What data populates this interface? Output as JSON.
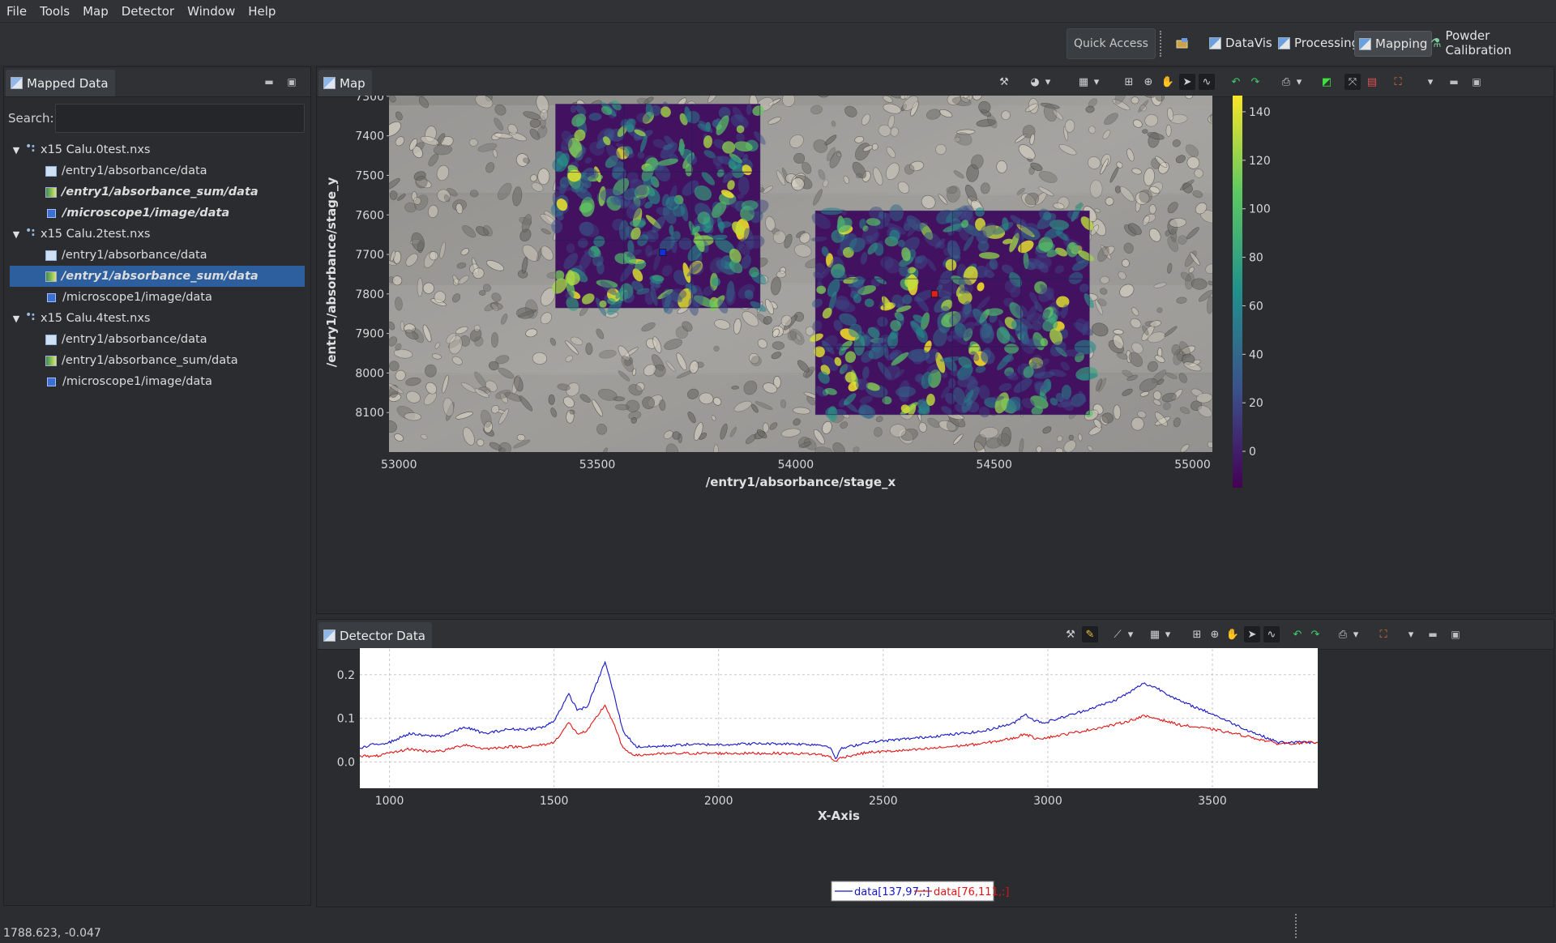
{
  "menu": [
    "File",
    "Tools",
    "Map",
    "Detector",
    "Window",
    "Help"
  ],
  "perspectives": {
    "quick_access": "Quick Access",
    "items": [
      {
        "label": "DataVis",
        "active": false
      },
      {
        "label": "Processing",
        "active": false
      },
      {
        "label": "Mapping",
        "active": true
      },
      {
        "label": "Powder Calibration",
        "active": false
      }
    ]
  },
  "mapped_data": {
    "tab_label": "Mapped Data",
    "search_label": "Search:",
    "search_value": "",
    "files": [
      {
        "name": "x15 Calu.0test.nxs",
        "datasets": [
          {
            "path": "/entry1/absorbance/data",
            "kind": "data",
            "emph": false,
            "selected": false
          },
          {
            "path": "/entry1/absorbance_sum/data",
            "kind": "sum",
            "emph": true,
            "selected": false
          },
          {
            "path": "/microscope1/image/data",
            "kind": "img",
            "emph": true,
            "selected": false
          }
        ]
      },
      {
        "name": "x15 Calu.2test.nxs",
        "datasets": [
          {
            "path": "/entry1/absorbance/data",
            "kind": "data",
            "emph": false,
            "selected": false
          },
          {
            "path": "/entry1/absorbance_sum/data",
            "kind": "sum",
            "emph": true,
            "selected": true
          },
          {
            "path": "/microscope1/image/data",
            "kind": "img",
            "emph": false,
            "selected": false
          }
        ]
      },
      {
        "name": "x15 Calu.4test.nxs",
        "datasets": [
          {
            "path": "/entry1/absorbance/data",
            "kind": "data",
            "emph": false,
            "selected": false
          },
          {
            "path": "/entry1/absorbance_sum/data",
            "kind": "sum",
            "emph": false,
            "selected": false
          },
          {
            "path": "/microscope1/image/data",
            "kind": "img",
            "emph": false,
            "selected": false
          }
        ]
      }
    ]
  },
  "map": {
    "tab_label": "Map",
    "chart_data": {
      "type": "heatmap",
      "xlabel": "/entry1/absorbance/stage_x",
      "ylabel": "/entry1/absorbance/stage_y",
      "xlim": [
        52975,
        55050
      ],
      "ylim": [
        7290,
        8200
      ],
      "x_ticks": [
        53000,
        53500,
        54000,
        54500,
        55000
      ],
      "y_ticks": [
        7300,
        7400,
        7500,
        7600,
        7700,
        7800,
        7900,
        8000,
        8100
      ],
      "colorbar": {
        "min": -15,
        "max": 148,
        "ticks": [
          0,
          20,
          40,
          60,
          80,
          100,
          120,
          140
        ],
        "colormap": "viridis"
      },
      "background_image": "microscope1 image (grayscale cells)",
      "overlays": [
        {
          "x_range": [
            53395,
            53910
          ],
          "y_range": [
            7320,
            7835
          ],
          "grid": [
            3,
            3
          ]
        },
        {
          "x_range": [
            54050,
            54740
          ],
          "y_range": [
            7590,
            8105
          ],
          "grid": [
            4,
            3
          ]
        }
      ],
      "markers": [
        {
          "x": 53665,
          "y": 7695,
          "color": "#1030e0"
        },
        {
          "x": 54350,
          "y": 7800,
          "color": "#e02020"
        }
      ]
    }
  },
  "detector": {
    "tab_label": "Detector Data",
    "chart_data": {
      "type": "line",
      "xlabel": "X-Axis",
      "ylabel": "",
      "xlim": [
        910,
        3820
      ],
      "ylim": [
        -0.06,
        0.27
      ],
      "x_ticks": [
        1000,
        1500,
        2000,
        2500,
        3000,
        3500
      ],
      "y_ticks": [
        0.0,
        0.1,
        0.2
      ],
      "grid": true,
      "legend": "bottom-center",
      "series": [
        {
          "name": "data[137,97,:]",
          "color": "#1515c8",
          "points": [
            [
              910,
              0.03
            ],
            [
              950,
              0.04
            ],
            [
              1000,
              0.045
            ],
            [
              1060,
              0.065
            ],
            [
              1110,
              0.06
            ],
            [
              1160,
              0.06
            ],
            [
              1230,
              0.08
            ],
            [
              1290,
              0.065
            ],
            [
              1360,
              0.075
            ],
            [
              1420,
              0.075
            ],
            [
              1470,
              0.08
            ],
            [
              1500,
              0.095
            ],
            [
              1530,
              0.135
            ],
            [
              1545,
              0.155
            ],
            [
              1570,
              0.12
            ],
            [
              1600,
              0.125
            ],
            [
              1640,
              0.2
            ],
            [
              1655,
              0.23
            ],
            [
              1680,
              0.16
            ],
            [
              1710,
              0.07
            ],
            [
              1750,
              0.035
            ],
            [
              1800,
              0.035
            ],
            [
              1900,
              0.04
            ],
            [
              2000,
              0.04
            ],
            [
              2100,
              0.042
            ],
            [
              2200,
              0.042
            ],
            [
              2300,
              0.04
            ],
            [
              2340,
              0.035
            ],
            [
              2355,
              0.005
            ],
            [
              2370,
              0.03
            ],
            [
              2450,
              0.045
            ],
            [
              2600,
              0.055
            ],
            [
              2800,
              0.07
            ],
            [
              2900,
              0.09
            ],
            [
              2930,
              0.11
            ],
            [
              2960,
              0.095
            ],
            [
              2990,
              0.09
            ],
            [
              3100,
              0.115
            ],
            [
              3200,
              0.14
            ],
            [
              3250,
              0.16
            ],
            [
              3290,
              0.18
            ],
            [
              3330,
              0.17
            ],
            [
              3400,
              0.14
            ],
            [
              3500,
              0.11
            ],
            [
              3600,
              0.075
            ],
            [
              3700,
              0.045
            ],
            [
              3820,
              0.045
            ]
          ]
        },
        {
          "name": "data[76,111,:]",
          "color": "#e01515",
          "points": [
            [
              910,
              0.015
            ],
            [
              950,
              0.012
            ],
            [
              1000,
              0.02
            ],
            [
              1060,
              0.03
            ],
            [
              1110,
              0.025
            ],
            [
              1160,
              0.025
            ],
            [
              1230,
              0.04
            ],
            [
              1290,
              0.03
            ],
            [
              1360,
              0.035
            ],
            [
              1420,
              0.035
            ],
            [
              1470,
              0.04
            ],
            [
              1500,
              0.045
            ],
            [
              1530,
              0.075
            ],
            [
              1545,
              0.09
            ],
            [
              1570,
              0.065
            ],
            [
              1600,
              0.07
            ],
            [
              1640,
              0.115
            ],
            [
              1655,
              0.13
            ],
            [
              1680,
              0.09
            ],
            [
              1710,
              0.03
            ],
            [
              1750,
              0.015
            ],
            [
              1800,
              0.018
            ],
            [
              1900,
              0.02
            ],
            [
              2000,
              0.02
            ],
            [
              2100,
              0.02
            ],
            [
              2200,
              0.02
            ],
            [
              2300,
              0.018
            ],
            [
              2340,
              0.012
            ],
            [
              2355,
              0.0
            ],
            [
              2370,
              0.01
            ],
            [
              2450,
              0.022
            ],
            [
              2600,
              0.028
            ],
            [
              2800,
              0.042
            ],
            [
              2900,
              0.055
            ],
            [
              2930,
              0.065
            ],
            [
              2960,
              0.055
            ],
            [
              2990,
              0.055
            ],
            [
              3100,
              0.07
            ],
            [
              3200,
              0.085
            ],
            [
              3250,
              0.095
            ],
            [
              3290,
              0.105
            ],
            [
              3330,
              0.1
            ],
            [
              3400,
              0.085
            ],
            [
              3500,
              0.075
            ],
            [
              3600,
              0.06
            ],
            [
              3700,
              0.042
            ],
            [
              3820,
              0.045
            ]
          ]
        }
      ]
    }
  },
  "status": {
    "coords": "1788.623, -0.047"
  }
}
